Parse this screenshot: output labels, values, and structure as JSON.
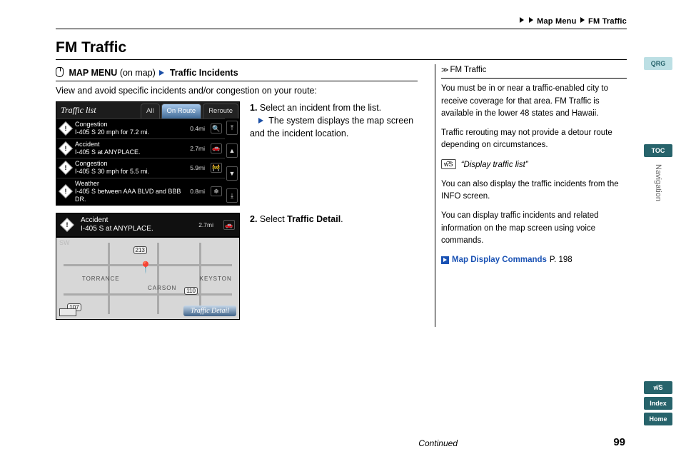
{
  "breadcrumb": {
    "a": "Map Menu",
    "b": "FM Traffic"
  },
  "title": "FM Traffic",
  "path": {
    "menu": "MAP MENU",
    "hint": "(on map)",
    "item": "Traffic Incidents"
  },
  "intro": "View and avoid specific incidents and/or congestion on your route:",
  "screenshot1": {
    "header": "Traffic list",
    "tabs": {
      "all": "All",
      "onroute": "On Route",
      "reroute": "Reroute"
    },
    "rows": [
      {
        "title": "Congestion",
        "sub": "I-405 S 20 mph for 7.2 mi.",
        "dist": "0.4mi",
        "icon": "🔍"
      },
      {
        "title": "Accident",
        "sub": "I-405 S at ANYPLACE.",
        "dist": "2.7mi",
        "icon": "🚗"
      },
      {
        "title": "Congestion",
        "sub": "I-405 S 30 mph for 5.5 mi.",
        "dist": "5.9mi",
        "icon": "🚧"
      },
      {
        "title": "Weather",
        "sub": "I-405 S between AAA BLVD and BBB DR.",
        "dist": "0.8mi",
        "icon": "❄"
      }
    ]
  },
  "step1": {
    "num": "1.",
    "text": "Select an incident from the list.",
    "sub": "The system displays the map screen and the incident location."
  },
  "screenshot2": {
    "title": "Accident",
    "sub": "I-405 S at ANYPLACE.",
    "dist": "2.7mi",
    "dir": "SW",
    "city1": "TORRANCE",
    "city2": "CARSON",
    "city3": "KEYSTON",
    "route1": "107",
    "route2": "213",
    "route3": "110",
    "btn": "Traffic Detail"
  },
  "step2": {
    "num": "2.",
    "pre": "Select ",
    "bold": "Traffic Detail",
    "post": "."
  },
  "side": {
    "header": "FM Traffic",
    "p1": "You must be in or near a traffic-enabled city to receive coverage for that area. FM Traffic is available in the lower 48 states and Hawaii.",
    "p2": "Traffic rerouting may not provide a detour route depending on circumstances.",
    "voice_label": "w͡S",
    "voice_cmd": "“Display traffic list”",
    "p3": "You can also display the traffic incidents from the INFO screen.",
    "p4": "You can display traffic incidents and related information on the map screen using voice commands.",
    "link": "Map Display Commands",
    "link_page": "P. 198"
  },
  "rail": {
    "qrg": "QRG",
    "toc": "TOC",
    "section": "Navigation",
    "voice": "w͡S",
    "index": "Index",
    "home": "Home"
  },
  "footer": {
    "continued": "Continued",
    "page": "99"
  }
}
